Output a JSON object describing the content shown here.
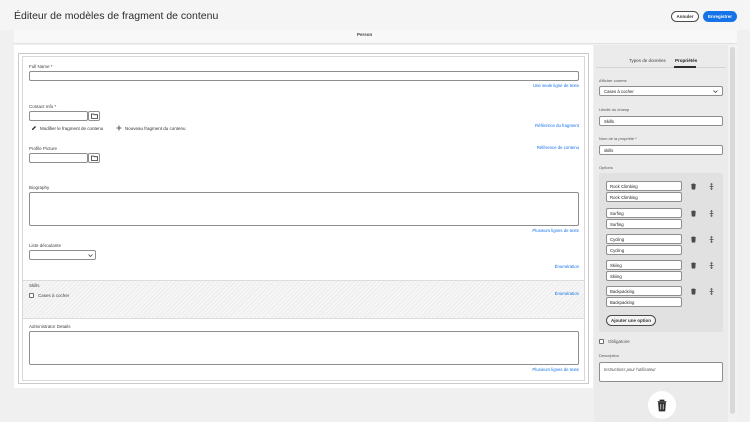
{
  "header": {
    "title": "Éditeur de modèles de fragment de contenu",
    "cancel_label": "Annuler",
    "save_label": "Enregistrer"
  },
  "model": {
    "name": "Person"
  },
  "form": {
    "full_name": {
      "label": "Full Name *",
      "type_link": "Une seule ligne de texte"
    },
    "contact_info": {
      "label": "Contact Info *",
      "type_link": "Référence du fragment",
      "edit_action": "Modifier le fragment de contenu",
      "new_action": "Nouveau fragment du contenu"
    },
    "profile_picture": {
      "label": "Profile Picture",
      "type_link": "Référence de contenu"
    },
    "biography": {
      "label": "Biography",
      "type_link": "Plusieurs lignes de texte"
    },
    "dropdown": {
      "label": "Liste déroulante",
      "type_link": "Énumération"
    },
    "skills": {
      "label": "Skills",
      "checkbox_label": "Cases à cocher",
      "type_link": "Énumération"
    },
    "admin_details": {
      "label": "Administrator Details",
      "type_link": "Plusieurs lignes de texte"
    }
  },
  "panel": {
    "tabs": [
      "Types de données",
      "Propriétés"
    ],
    "active_tab": "Propriétés",
    "render_as": {
      "label": "Afficher comme",
      "value": "Cases à cocher"
    },
    "field_label": {
      "label": "Libellé du champ",
      "value": "Skills"
    },
    "property_name": {
      "label": "Nom de la propriété *",
      "value": "skills"
    },
    "options_label": "Options",
    "options": [
      {
        "text": "Rock Climbing",
        "value": "Rock Climbing"
      },
      {
        "text": "Surfing",
        "value": "Surfing"
      },
      {
        "text": "Cycling",
        "value": "Cycling"
      },
      {
        "text": "Skiing",
        "value": "Skiing"
      },
      {
        "text": "Backpacking",
        "value": "Backpacking"
      }
    ],
    "add_option_label": "Ajouter une option",
    "required_label": "Obligatoire",
    "description": {
      "label": "Description",
      "placeholder": "Instructions pour l'utilisateur"
    }
  },
  "colors": {
    "accent": "#1473e6",
    "panel_bg": "#ebebeb"
  },
  "icons": [
    "folder-icon",
    "pencil-icon",
    "plus-icon",
    "chevron-down-icon",
    "trash-icon",
    "drag-handle-icon"
  ]
}
